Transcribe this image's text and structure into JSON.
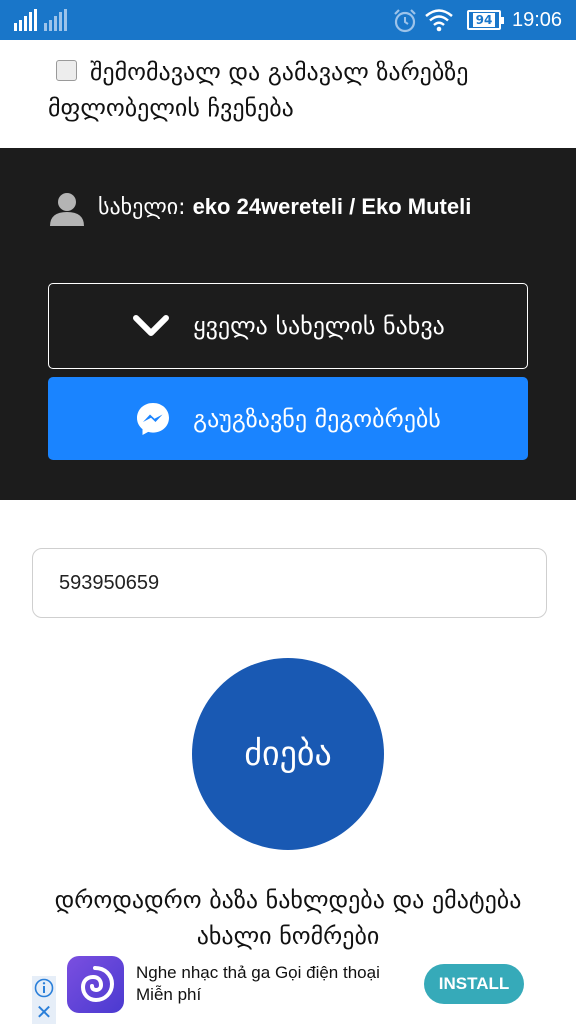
{
  "status_bar": {
    "time": "19:06",
    "battery": "94",
    "icons": [
      "signal-icon",
      "alarm-icon",
      "wifi-icon",
      "battery-icon"
    ]
  },
  "options": {
    "show_owner_label": "შემომავალ და გამავალ ზარებზე მფლობელის ჩვენება",
    "show_owner_checked": false
  },
  "profile": {
    "name_label": "სახელი:",
    "name_value": "eko 24wereteli / Eko Muteli",
    "see_all_label": "ყველა სახელის ნახვა",
    "send_label": "გაუგზავნე მეგობრებს"
  },
  "search": {
    "phone_value": "593950659",
    "button_label": "ძიება",
    "info_text": "დროდადრო ბაზა ნახლდება და ემატება ახალი ნომრები"
  },
  "ad": {
    "title": "Nghe nhạc thả ga Gọi điện thoại Miễn phí",
    "install_label": "INSTALL"
  },
  "colors": {
    "status_bar": "#1976c9",
    "dark_section": "#1c1c1c",
    "messenger_button": "#1a84ff",
    "search_button": "#1959b3",
    "install_button": "#36aab9"
  }
}
